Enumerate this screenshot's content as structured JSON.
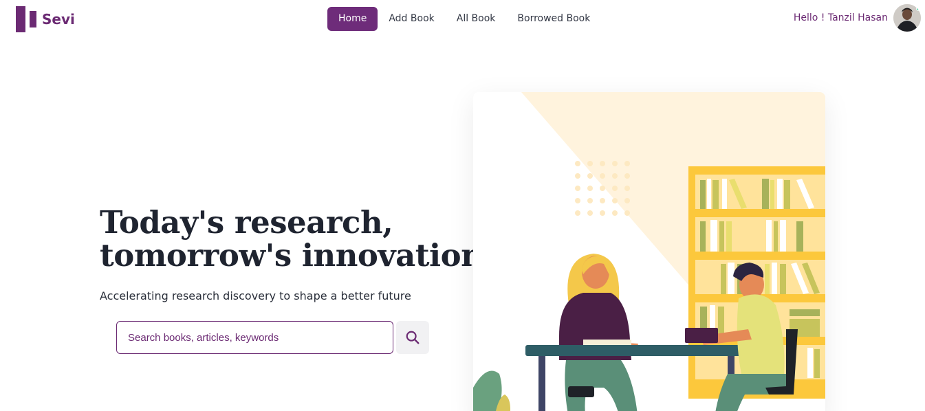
{
  "brand": {
    "name": "Sevi",
    "color": "#6b2a73"
  },
  "nav": {
    "items": [
      {
        "label": "Home",
        "active": true
      },
      {
        "label": "Add Book",
        "active": false
      },
      {
        "label": "All Book",
        "active": false
      },
      {
        "label": "Borrowed Book",
        "active": false
      }
    ]
  },
  "user": {
    "greeting": "Hello ! Tanzil Hasan",
    "status": "online",
    "status_color": "#1ecb8a"
  },
  "hero": {
    "title_line1": "Today's research,",
    "title_line2": "tomorrow's innovation",
    "subtitle": "Accelerating research discovery to shape a better future"
  },
  "search": {
    "placeholder": "Search books, articles, keywords",
    "icon": "search-icon"
  },
  "illustration": {
    "subject": "reading-at-library-table-illustration"
  }
}
